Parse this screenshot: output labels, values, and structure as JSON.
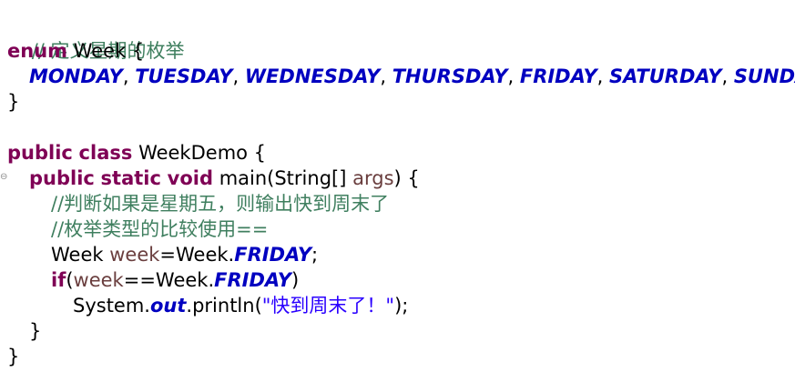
{
  "code": {
    "comment_enum": "// 定义星期的枚举",
    "kw_enum": "enum",
    "enum_name": "Week {",
    "enum_constants": [
      "MONDAY",
      "TUESDAY",
      "WEDNESDAY",
      "THURSDAY",
      "FRIDAY",
      "SATURDAY",
      "SUNDAY"
    ],
    "sep": ",",
    "close_brace": "}",
    "kw_public": "public",
    "kw_class": "class",
    "class_name": "WeekDemo {",
    "kw_static": "static",
    "kw_void": "void",
    "method_sig_main": "main(String[]",
    "method_param": "args",
    "method_sig_end": ") {",
    "comment_1": "//判断如果是星期五，则输出快到周末了",
    "comment_2": "//枚举类型的比较使用==",
    "decl_type": "Week",
    "decl_var": "week",
    "decl_eq": "=Week.",
    "decl_const": "FRIDAY",
    "decl_end": ";",
    "kw_if": "if",
    "if_open": "(",
    "if_var": "week",
    "if_mid": "==Week.",
    "if_const": "FRIDAY",
    "if_close": ")",
    "println_pre": "System.",
    "println_field": "out",
    "println_mid": ".println(",
    "println_str": "\"快到周末了！\"",
    "println_end": ");",
    "fold_glyph": "⊖"
  }
}
